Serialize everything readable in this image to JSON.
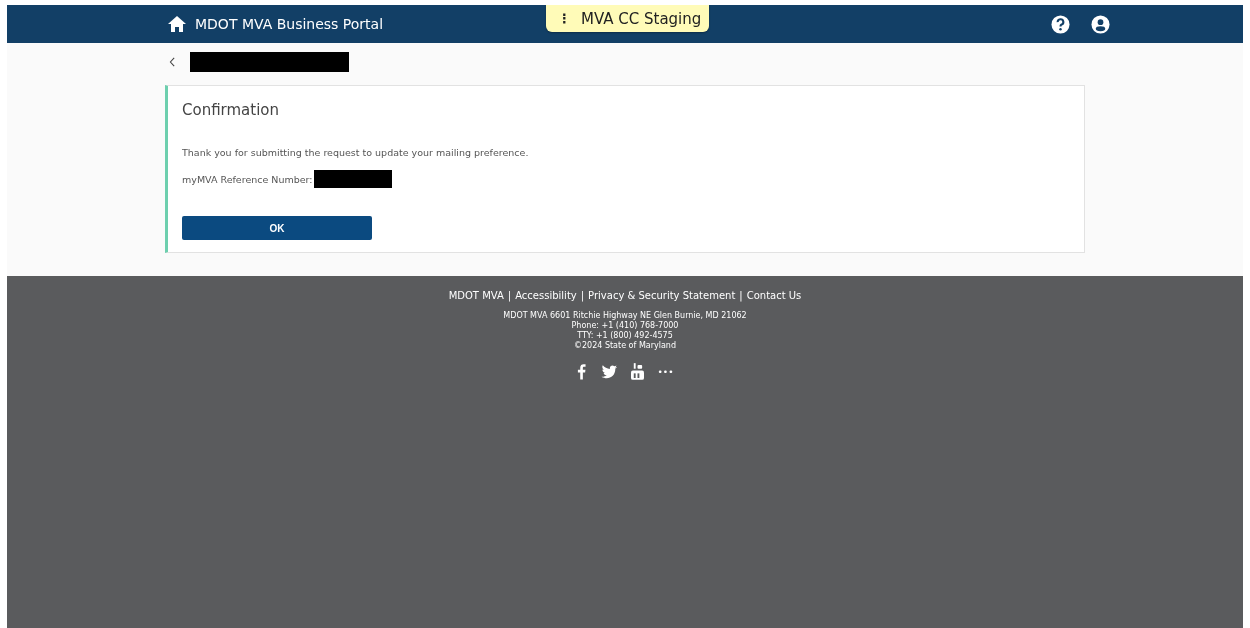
{
  "header": {
    "title": "MDOT MVA Business Portal",
    "environment_badge": {
      "menu_glyph": "⋮",
      "label": "MVA CC Staging"
    }
  },
  "card": {
    "title": "Confirmation",
    "message": "Thank you for submitting the request to update your mailing preference.",
    "reference_label": "myMVA Reference Number:",
    "button": "OK"
  },
  "footer": {
    "separator": "|",
    "links": [
      "MDOT MVA",
      "Accessibility",
      "Privacy & Security Statement",
      "Contact Us"
    ],
    "address_lines": [
      "MDOT MVA 6601 Ritchie Highway NE Glen Burnie, MD 21062",
      "Phone: +1 (410) 768-7000",
      "TTY: +1 (800) 492-4575",
      "©2024 State of Maryland"
    ],
    "more_glyph": "•••"
  }
}
